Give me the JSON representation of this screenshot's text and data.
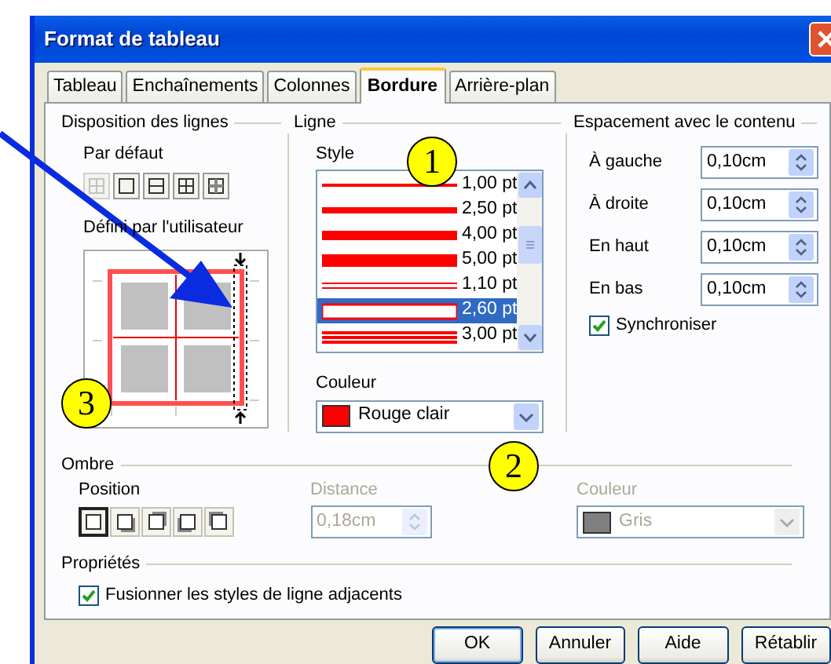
{
  "window": {
    "title": "Format de tableau"
  },
  "tabs": [
    {
      "label": "Tableau",
      "selected": false
    },
    {
      "label": "Enchaînements",
      "selected": false
    },
    {
      "label": "Colonnes",
      "selected": false
    },
    {
      "label": "Bordure",
      "selected": true
    },
    {
      "label": "Arrière-plan",
      "selected": false
    }
  ],
  "line_arrangement": {
    "title": "Disposition des lignes",
    "default_label": "Par défaut",
    "presets": [
      {
        "kind": "none",
        "disabled": true
      },
      {
        "kind": "outer",
        "disabled": false
      },
      {
        "kind": "outer-horizontal",
        "disabled": false
      },
      {
        "kind": "all",
        "disabled": false
      },
      {
        "kind": "outer-only-inner",
        "disabled": false
      }
    ],
    "user_label": "Défini par l'utilisateur"
  },
  "line": {
    "title": "Ligne",
    "style_label": "Style",
    "styles": [
      {
        "label": "1,00 pt",
        "kind": "fine",
        "selected": false
      },
      {
        "label": "2,50 pt",
        "kind": "regular",
        "selected": false
      },
      {
        "label": "4,00 pt",
        "kind": "bold",
        "selected": false
      },
      {
        "label": "5,00 pt",
        "kind": "heavy",
        "selected": false
      },
      {
        "label": "1,10 pt",
        "kind": "doublefine",
        "selected": false
      },
      {
        "label": "2,60 pt",
        "kind": "double",
        "selected": true
      },
      {
        "label": "3,00 pt",
        "kind": "doublewide",
        "selected": false
      }
    ],
    "color_label": "Couleur",
    "color": {
      "value": "Rouge clair",
      "color": "#ff0000"
    }
  },
  "spacing": {
    "title": "Espacement avec le contenu",
    "fields": [
      {
        "label": "À gauche",
        "value": "0,10cm"
      },
      {
        "label": "À droite",
        "value": "0,10cm"
      },
      {
        "label": "En haut",
        "value": "0,10cm"
      },
      {
        "label": "En bas",
        "value": "0,10cm"
      }
    ],
    "synchronize": {
      "label": "Synchroniser",
      "checked": true
    }
  },
  "shadow": {
    "title": "Ombre",
    "position_label": "Position",
    "positions": [
      {
        "kind": "none",
        "selected": true
      },
      {
        "kind": "bottom-right",
        "selected": false
      },
      {
        "kind": "top-right",
        "selected": false
      },
      {
        "kind": "bottom-left",
        "selected": false
      },
      {
        "kind": "top-left",
        "selected": false
      }
    ],
    "distance": {
      "label": "Distance",
      "value": "0,18cm",
      "disabled": true
    },
    "color": {
      "label": "Couleur",
      "value": "Gris",
      "color": "#808080",
      "disabled": true
    }
  },
  "properties": {
    "title": "Propriétés",
    "merge": {
      "label": "Fusionner les styles de ligne adjacents",
      "checked": true
    }
  },
  "buttons": [
    {
      "label": "OK",
      "default": true
    },
    {
      "label": "Annuler",
      "default": false
    },
    {
      "label": "Aide",
      "default": false
    },
    {
      "label": "Rétablir",
      "default": false
    }
  ],
  "annotations": [
    {
      "label": "1"
    },
    {
      "label": "2"
    },
    {
      "label": "3"
    }
  ]
}
